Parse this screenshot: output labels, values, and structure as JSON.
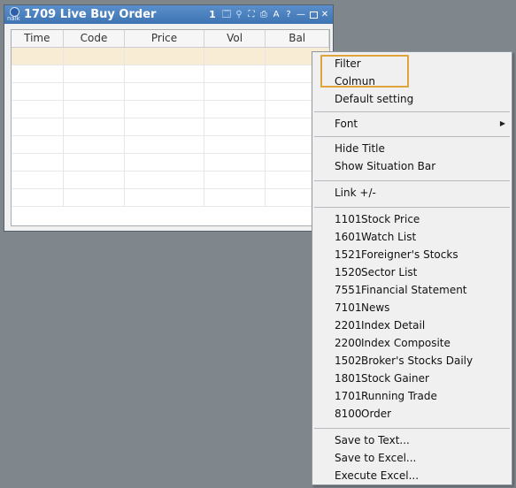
{
  "window": {
    "title": "1709 Live Buy Order",
    "logo_text": "nalk",
    "toolbar": {
      "number": "1",
      "icons": [
        "window-icon",
        "pin-icon",
        "expand-icon",
        "print-icon",
        "font-a-icon",
        "help-icon",
        "minimize-icon",
        "maximize-icon",
        "close-icon"
      ],
      "glyphs": {
        "window": "🗔",
        "pin": "⚲",
        "expand": "⛶",
        "print": "⎙",
        "font": "A",
        "help": "?",
        "minimize": "—",
        "close": "✕"
      }
    },
    "columns": [
      "Time",
      "Code",
      "Price",
      "Vol",
      "Bal"
    ],
    "row_count": 9,
    "selected_row": 0
  },
  "context_menu": {
    "items_group1": [
      "Filter",
      "Colmun",
      "Default setting"
    ],
    "font_label": "Font",
    "submenu_arrow": "▶",
    "items_group2": [
      "Hide Title",
      "Show Situation Bar"
    ],
    "link_label": "Link +/-",
    "screens": [
      {
        "code": "1101",
        "label": "Stock Price"
      },
      {
        "code": "1601",
        "label": "Watch List"
      },
      {
        "code": "1521",
        "label": "Foreigner's Stocks"
      },
      {
        "code": "1520",
        "label": "Sector List"
      },
      {
        "code": "7551",
        "label": "Financial Statement"
      },
      {
        "code": "7101",
        "label": "News"
      },
      {
        "code": "2201",
        "label": "Index Detail"
      },
      {
        "code": "2200",
        "label": "Index Composite"
      },
      {
        "code": "1502",
        "label": "Broker's Stocks Daily"
      },
      {
        "code": "1801",
        "label": "Stock Gainer"
      },
      {
        "code": "1701",
        "label": "Running Trade"
      },
      {
        "code": "8100",
        "label": "Order"
      }
    ],
    "export_items": [
      "Save to Text...",
      "Save to Excel...",
      "Execute Excel..."
    ],
    "highlight_color": "#e0a43d"
  }
}
